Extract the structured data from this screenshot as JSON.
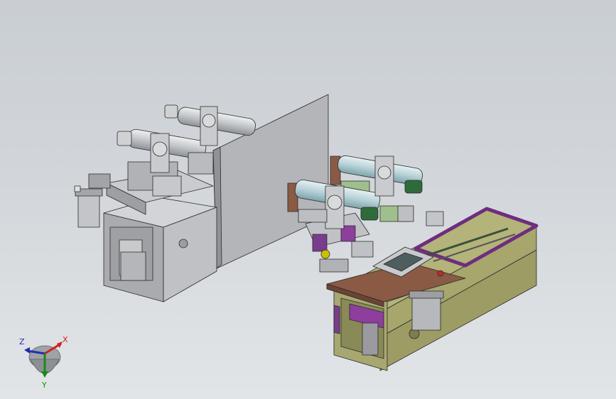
{
  "viewport": {
    "background_top": "#c9ced3",
    "background_bottom": "#e2e5e8"
  },
  "triad": {
    "x_label": "X",
    "y_label": "Y",
    "z_label": "Z",
    "x_color": "#d12020",
    "y_color": "#1a8a1a",
    "z_color": "#1f2fb0"
  },
  "colors": {
    "metal_gray": "#b7b9bd",
    "olive": "#9a9a62",
    "purple": "#7a3c8c",
    "brown": "#8a5a44",
    "cylinder_blue": "#bcd6dc",
    "green_knob": "#2f6b3a",
    "accent_red": "#c22a2a"
  }
}
